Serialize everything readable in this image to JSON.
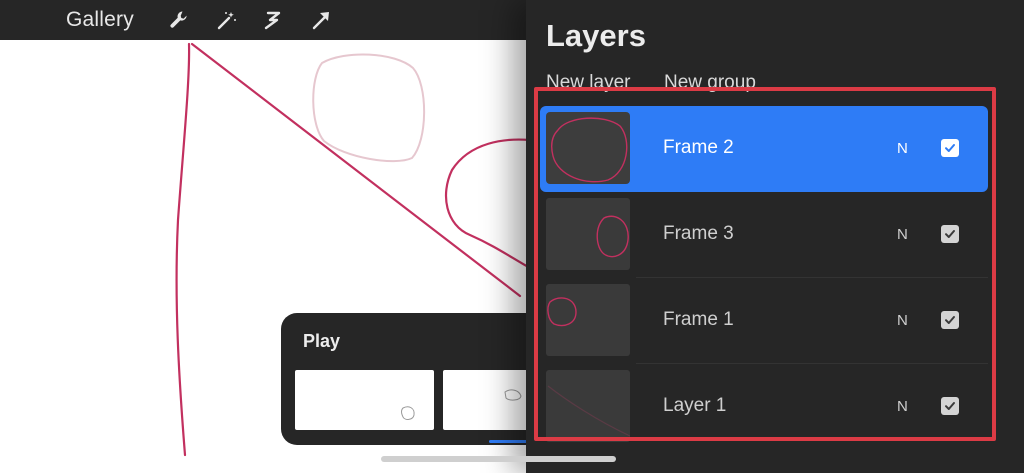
{
  "toolbar": {
    "gallery_label": "Gallery",
    "icons": [
      "wrench-icon",
      "magic-wand-icon",
      "selection-icon",
      "transform-arrow-icon"
    ]
  },
  "play_panel": {
    "play_label": "Play"
  },
  "layers_panel": {
    "title": "Layers",
    "new_layer_label": "New layer",
    "new_group_label": "New group",
    "layers": [
      {
        "name": "Frame 2",
        "mode": "N",
        "visible": true,
        "selected": true
      },
      {
        "name": "Frame 3",
        "mode": "N",
        "visible": true,
        "selected": false
      },
      {
        "name": "Frame 1",
        "mode": "N",
        "visible": true,
        "selected": false
      },
      {
        "name": "Layer 1",
        "mode": "N",
        "visible": true,
        "selected": false
      }
    ]
  },
  "colors": {
    "accent": "#2e7cf6",
    "panel_bg": "#262626",
    "stroke": "#c2305f",
    "highlight": "#dc3b45"
  }
}
